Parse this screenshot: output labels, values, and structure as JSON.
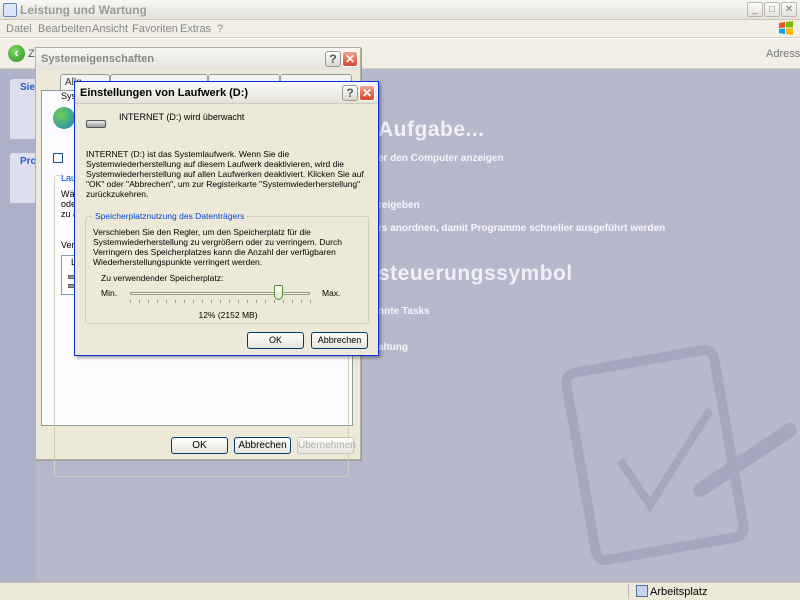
{
  "main_window": {
    "title": "Leistung und Wartung",
    "menu": [
      "Datei",
      "Bearbeiten",
      "Ansicht",
      "Favoriten",
      "Extras",
      "?"
    ],
    "back_label": "Zu",
    "address_label": "Adresse",
    "status_text": "Arbeitsplatz"
  },
  "background_content": {
    "heading1": "Aufgabe...",
    "heading2": "steuerungssymbol",
    "tasks": [
      "er den Computer anzeigen",
      "reigeben",
      "rs anordnen, damit Programme schneller ausgeführt werden",
      "nnte Tasks",
      "altung"
    ],
    "left_labels": [
      "Siel",
      "Pro"
    ]
  },
  "system_properties": {
    "title": "Systemeigenschaften",
    "tabs": [
      "Allg",
      "Sys"
    ],
    "panel_fragments": [
      "Sys",
      "Lau",
      "Wä",
      "ode",
      "zu ä",
      "Verl",
      "L"
    ],
    "ok": "OK",
    "cancel": "Abbrechen",
    "apply": "Übernehmen"
  },
  "drive_dialog": {
    "title": "Einstellungen von Laufwerk (D:)",
    "drive_name": "INTERNET (D:)",
    "drive_status": "wird überwacht",
    "info_text": "INTERNET (D:) ist das Systemlaufwerk. Wenn Sie die Systemwiederherstellung auf diesem Laufwerk deaktivieren, wird die Systemwiederherstellung auf allen Laufwerken deaktiviert. Klicken Sie auf \"OK\" oder \"Abbrechen\", um zur Registerkarte \"Systemwiederherstellung\" zurückzukehren.",
    "group_title": "Speicherplatznutzung des Datenträgers",
    "group_text": "Verschieben Sie den Regler, um den Speicherplatz für die Systemwiederherstellung zu vergrößern oder zu verringern. Durch Verringern des Speicherplatzes kann die Anzahl der verfügbaren Wiederherstellungspunkte verringert werden.",
    "space_label": "Zu verwendender Speicherplatz:",
    "min_label": "Min.",
    "max_label": "Max.",
    "slider_fraction": 0.82,
    "usage_text": "12% (2152 MB)",
    "ok": "OK",
    "cancel": "Abbrechen"
  }
}
